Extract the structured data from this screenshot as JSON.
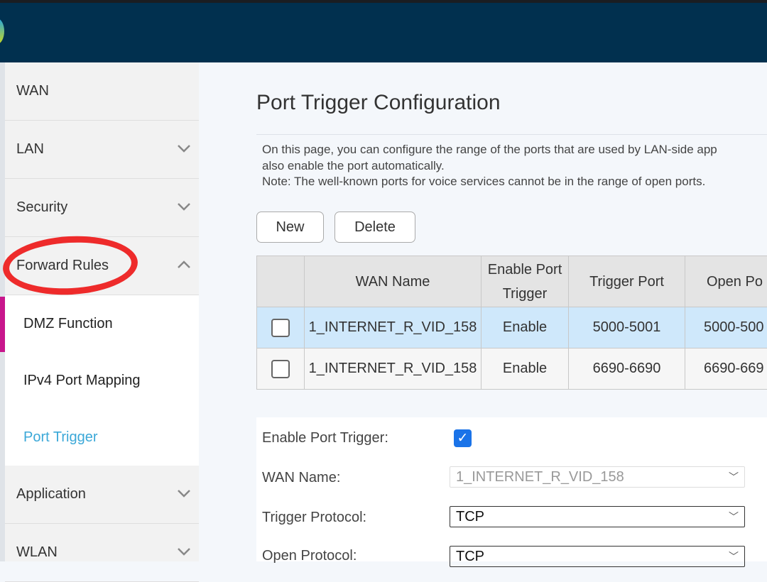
{
  "sidebar": {
    "items": [
      {
        "label": "WAN",
        "chevron": ""
      },
      {
        "label": "LAN",
        "chevron": "down"
      },
      {
        "label": "Security",
        "chevron": "down"
      },
      {
        "label": "Forward Rules",
        "chevron": "up"
      }
    ],
    "sub_items": [
      {
        "label": "DMZ Function"
      },
      {
        "label": "IPv4 Port Mapping"
      },
      {
        "label": "Port Trigger"
      }
    ],
    "items_after": [
      {
        "label": "Application"
      },
      {
        "label": "WLAN"
      }
    ]
  },
  "page": {
    "title": "Port Trigger Configuration",
    "desc1": "On this page, you can configure the range of the ports that are used by LAN-side app",
    "desc2": "also enable the port automatically.",
    "desc3": "Note: The well-known ports for voice services cannot be in the range of open ports."
  },
  "buttons": {
    "new": "New",
    "delete": "Delete"
  },
  "table": {
    "headers": [
      "WAN Name",
      "Enable Port Trigger",
      "Trigger Port",
      "Open Po"
    ],
    "rows": [
      {
        "wan": "1_INTERNET_R_VID_158",
        "enable": "Enable",
        "trigger": "5000-5001",
        "open": "5000-500"
      },
      {
        "wan": "1_INTERNET_R_VID_158",
        "enable": "Enable",
        "trigger": "6690-6690",
        "open": "6690-669"
      }
    ]
  },
  "form": {
    "enable_label": "Enable Port Trigger:",
    "enable_checked": true,
    "wan_label": "WAN Name:",
    "wan_value": "1_INTERNET_R_VID_158",
    "trigger_label": "Trigger Protocol:",
    "trigger_value": "TCP",
    "open_label": "Open Protocol:",
    "open_value": "TCP"
  }
}
